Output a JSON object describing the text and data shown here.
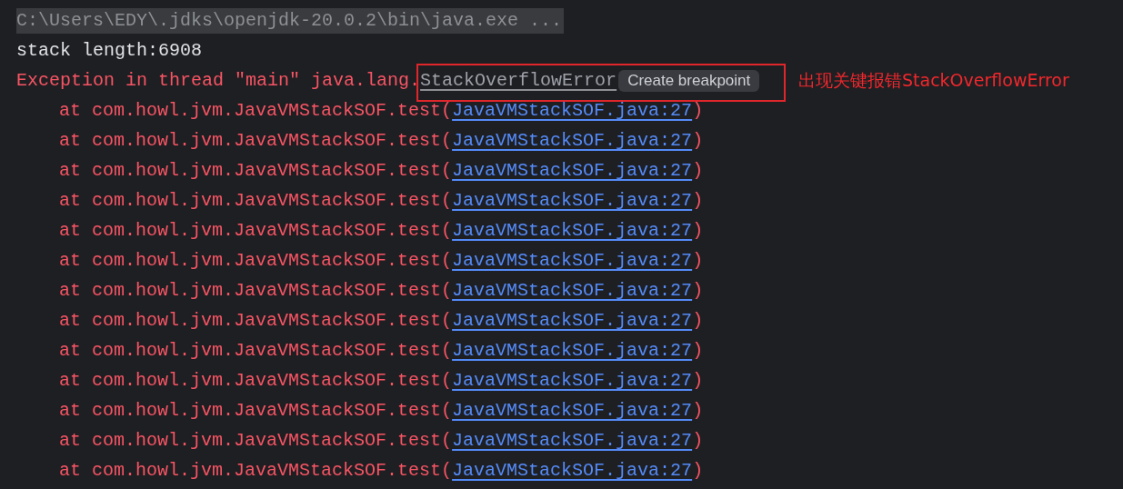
{
  "console": {
    "command": "C:\\Users\\EDY\\.jdks\\openjdk-20.0.2\\bin\\java.exe ...",
    "output": "stack length:6908",
    "exception": {
      "prefix": "Exception in thread \"main\" java.lang.",
      "class_name": "StackOverflowError",
      "tooltip": "Create breakpoint"
    },
    "frames": [
      {
        "method": "at com.howl.jvm.JavaVMStackSOF.test(",
        "link": "JavaVMStackSOF.java:27",
        "close": ")"
      },
      {
        "method": "at com.howl.jvm.JavaVMStackSOF.test(",
        "link": "JavaVMStackSOF.java:27",
        "close": ")"
      },
      {
        "method": "at com.howl.jvm.JavaVMStackSOF.test(",
        "link": "JavaVMStackSOF.java:27",
        "close": ")"
      },
      {
        "method": "at com.howl.jvm.JavaVMStackSOF.test(",
        "link": "JavaVMStackSOF.java:27",
        "close": ")"
      },
      {
        "method": "at com.howl.jvm.JavaVMStackSOF.test(",
        "link": "JavaVMStackSOF.java:27",
        "close": ")"
      },
      {
        "method": "at com.howl.jvm.JavaVMStackSOF.test(",
        "link": "JavaVMStackSOF.java:27",
        "close": ")"
      },
      {
        "method": "at com.howl.jvm.JavaVMStackSOF.test(",
        "link": "JavaVMStackSOF.java:27",
        "close": ")"
      },
      {
        "method": "at com.howl.jvm.JavaVMStackSOF.test(",
        "link": "JavaVMStackSOF.java:27",
        "close": ")"
      },
      {
        "method": "at com.howl.jvm.JavaVMStackSOF.test(",
        "link": "JavaVMStackSOF.java:27",
        "close": ")"
      },
      {
        "method": "at com.howl.jvm.JavaVMStackSOF.test(",
        "link": "JavaVMStackSOF.java:27",
        "close": ")"
      },
      {
        "method": "at com.howl.jvm.JavaVMStackSOF.test(",
        "link": "JavaVMStackSOF.java:27",
        "close": ")"
      },
      {
        "method": "at com.howl.jvm.JavaVMStackSOF.test(",
        "link": "JavaVMStackSOF.java:27",
        "close": ")"
      },
      {
        "method": "at com.howl.jvm.JavaVMStackSOF.test(",
        "link": "JavaVMStackSOF.java:27",
        "close": ")"
      }
    ]
  },
  "annotation": {
    "text": "出现关键报错StackOverflowError"
  }
}
